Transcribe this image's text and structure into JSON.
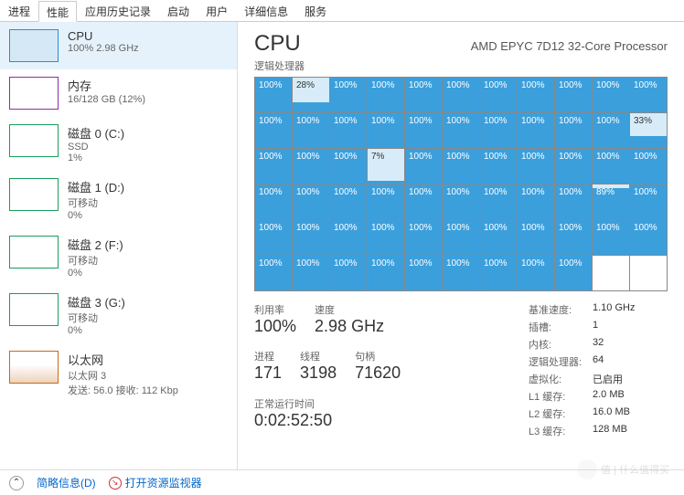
{
  "tabs": [
    "进程",
    "性能",
    "应用历史记录",
    "启动",
    "用户",
    "详细信息",
    "服务"
  ],
  "activeTab": 1,
  "sidebar": [
    {
      "id": "cpu",
      "title": "CPU",
      "sub": "100% 2.98 GHz",
      "selected": true,
      "color": "cpu"
    },
    {
      "id": "mem",
      "title": "内存",
      "sub": "16/128 GB (12%)",
      "color": "mem"
    },
    {
      "id": "disk0",
      "title": "磁盘 0 (C:)",
      "sub": "SSD",
      "sub2": "1%",
      "color": "disk"
    },
    {
      "id": "disk1",
      "title": "磁盘 1 (D:)",
      "sub": "可移动",
      "sub2": "0%",
      "color": "disk"
    },
    {
      "id": "disk2",
      "title": "磁盘 2 (F:)",
      "sub": "可移动",
      "sub2": "0%",
      "color": "disk"
    },
    {
      "id": "disk3",
      "title": "磁盘 3 (G:)",
      "sub": "可移动",
      "sub2": "0%",
      "color": "disk"
    },
    {
      "id": "eth",
      "title": "以太网",
      "sub": "以太网 3",
      "sub2": "发送: 56.0 接收: 112 Kbp",
      "color": "eth"
    }
  ],
  "header": {
    "title": "CPU",
    "model": "AMD EPYC 7D12 32-Core Processor",
    "sub": "逻辑处理器"
  },
  "cores": [
    100,
    28,
    100,
    100,
    100,
    100,
    100,
    100,
    100,
    100,
    100,
    100,
    100,
    100,
    100,
    100,
    100,
    100,
    100,
    100,
    100,
    33,
    100,
    100,
    100,
    7,
    100,
    100,
    100,
    100,
    100,
    100,
    100,
    100,
    100,
    100,
    100,
    100,
    100,
    100,
    100,
    100,
    89,
    100,
    100,
    100,
    100,
    100,
    100,
    100,
    100,
    100,
    100,
    100,
    100,
    100,
    100,
    100,
    100,
    100,
    100,
    100,
    100,
    100,
    null,
    null
  ],
  "statsL": {
    "util_lb": "利用率",
    "util": "100%",
    "speed_lb": "速度",
    "speed": "2.98 GHz",
    "proc_lb": "进程",
    "proc": "171",
    "thr_lb": "线程",
    "thr": "3198",
    "hnd_lb": "句柄",
    "hnd": "71620",
    "up_lb": "正常运行时间",
    "up": "0:02:52:50"
  },
  "statsR": [
    {
      "k": "基准速度:",
      "v": "1.10 GHz"
    },
    {
      "k": "插槽:",
      "v": "1"
    },
    {
      "k": "内核:",
      "v": "32"
    },
    {
      "k": "逻辑处理器:",
      "v": "64"
    },
    {
      "k": "虚拟化:",
      "v": "已启用"
    },
    {
      "k": "L1 缓存:",
      "v": "2.0 MB"
    },
    {
      "k": "L2 缓存:",
      "v": "16.0 MB"
    },
    {
      "k": "L3 缓存:",
      "v": "128 MB"
    }
  ],
  "footer": {
    "brief": "简略信息(D)",
    "resmon": "打开资源监视器"
  },
  "watermark": "值 | 什么值得买"
}
